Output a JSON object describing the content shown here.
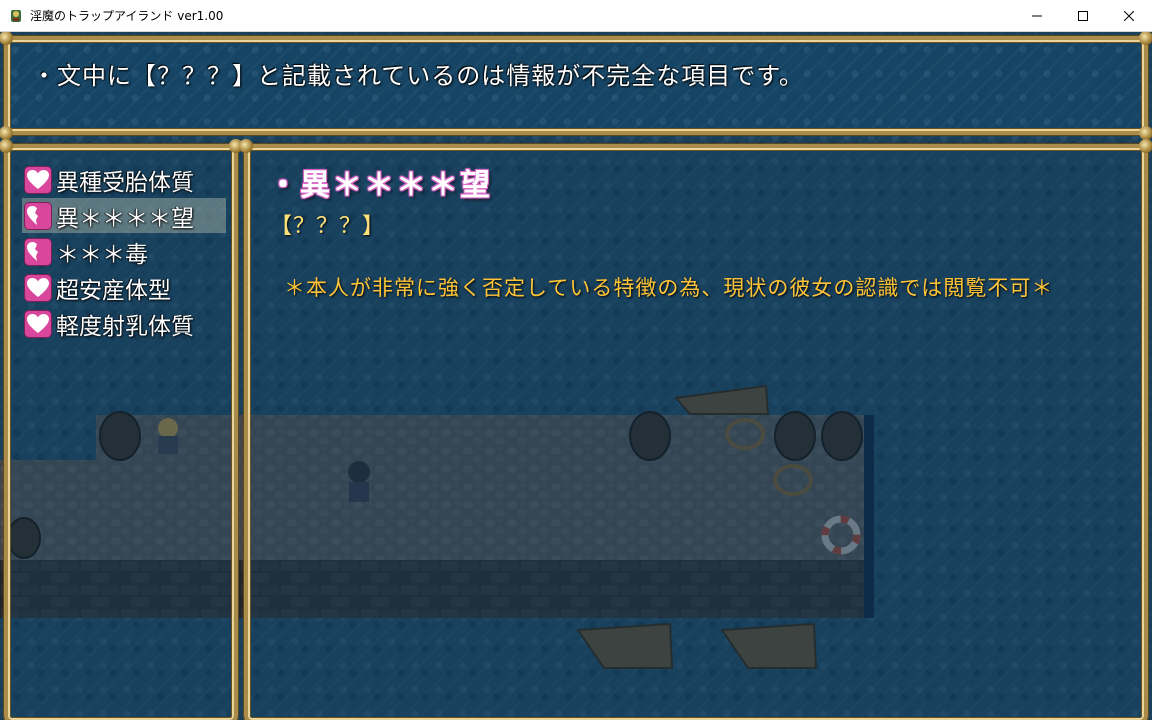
{
  "window": {
    "title": "淫魔のトラップアイランド ver1.00",
    "icon": "game-app-icon",
    "controls": [
      "minimize-icon",
      "maximize-icon",
      "close-icon"
    ]
  },
  "help": {
    "text": "・文中に【？？？】と記載されているのは情報が不完全な項目です。"
  },
  "trait_list": {
    "selected_index": 1,
    "items": [
      {
        "label": "異種受胎体質",
        "icon": "heart-icon"
      },
      {
        "label": "異＊＊＊＊望",
        "icon": "broken-heart-icon"
      },
      {
        "label": "＊＊＊毒",
        "icon": "broken-heart-icon"
      },
      {
        "label": "超安産体型",
        "icon": "heart-icon"
      },
      {
        "label": "軽度射乳体質",
        "icon": "heart-icon"
      }
    ]
  },
  "detail": {
    "title": "・異＊＊＊＊望",
    "info": "【？？？】",
    "description": "＊本人が非常に強く否定している特徴の為、現状の彼女の認識では閲覧不可＊"
  },
  "colors": {
    "window_frame": "#a98b4a",
    "window_bg": "#164666",
    "heart_box": "#d8479c",
    "info_text": "#ffe17a",
    "desc_text": "#ffc437",
    "title_glow": "#d15ec0"
  }
}
